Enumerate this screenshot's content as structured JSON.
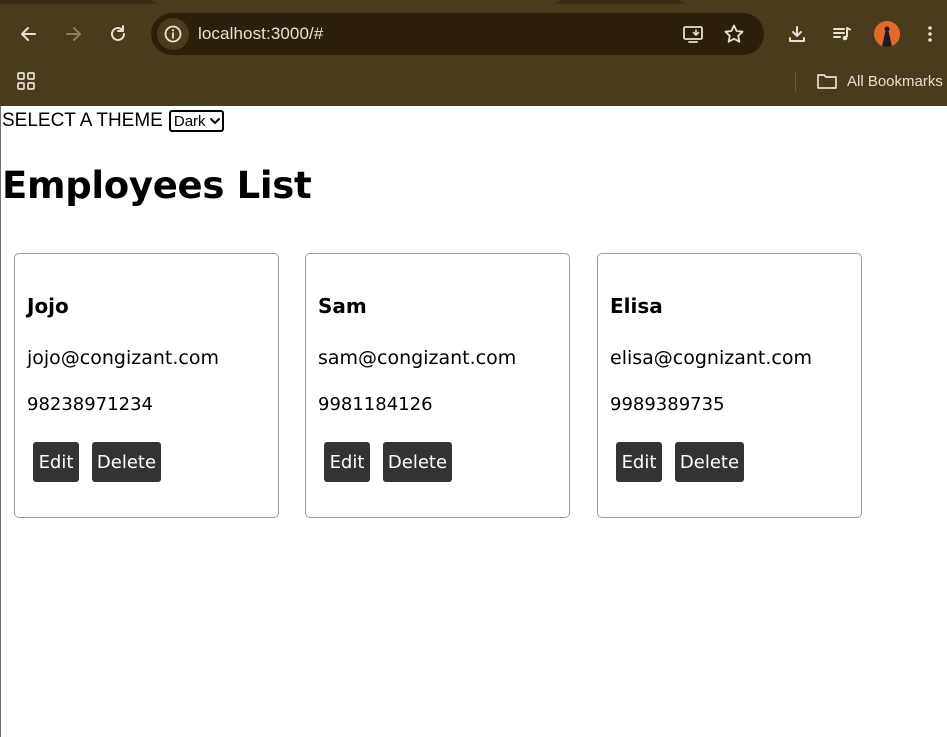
{
  "browser": {
    "url": "localhost:3000/#",
    "bookmarks_label": "All Bookmarks",
    "icons": [
      "back-icon",
      "forward-icon",
      "reload-icon",
      "site-info-icon",
      "install-app-icon",
      "star-icon",
      "download-icon",
      "media-control-icon",
      "profile-avatar",
      "more-menu-icon",
      "apps-grid-icon",
      "folder-icon"
    ],
    "colors": {
      "frame": "#4a3a1e",
      "omnibox": "#2c200c",
      "text": "#e8e0d2"
    }
  },
  "theme": {
    "label": "SELECT A THEME",
    "selected": "Dark"
  },
  "page_title": "Employees List",
  "employees": [
    {
      "name": "Jojo",
      "email": "jojo@congizant.com",
      "phone": "98238971234",
      "edit_label": "Edit",
      "delete_label": "Delete"
    },
    {
      "name": "Sam",
      "email": "sam@congizant.com",
      "phone": "9981184126",
      "edit_label": "Edit",
      "delete_label": "Delete"
    },
    {
      "name": "Elisa",
      "email": "elisa@cognizant.com",
      "phone": "9989389735",
      "edit_label": "Edit",
      "delete_label": "Delete"
    }
  ],
  "colors": {
    "button_bg": "#333333",
    "button_text": "#ffffff",
    "card_border": "#9a9a9a"
  }
}
